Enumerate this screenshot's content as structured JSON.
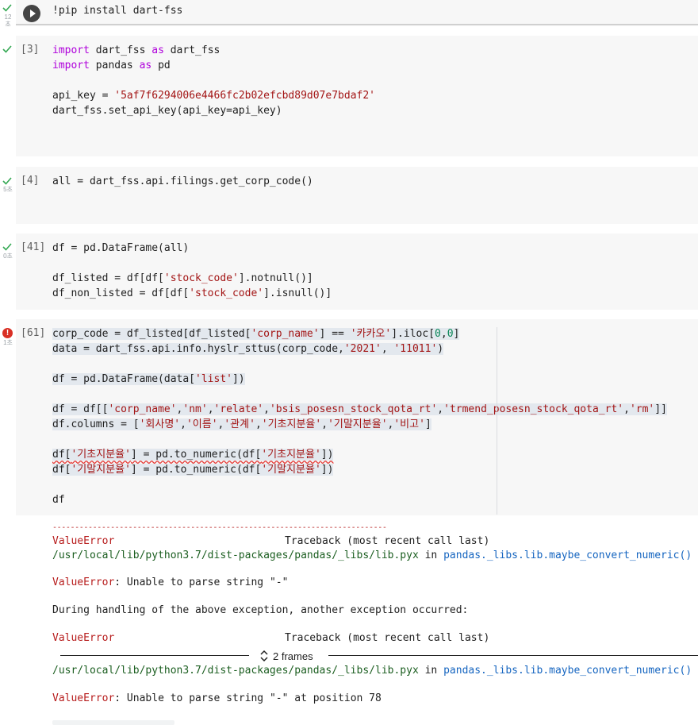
{
  "cells": {
    "c0": {
      "elapsed_num": "12",
      "elapsed_unit": "초",
      "code": "!pip install dart-fss"
    },
    "c1": {
      "count": "[3]",
      "lines": {
        "l1_a": "import",
        "l1_b": " dart_fss ",
        "l1_c": "as",
        "l1_d": " dart_fss",
        "l2_a": "import",
        "l2_b": " pandas ",
        "l2_c": "as",
        "l2_d": " pd",
        "l4_a": "api_key = ",
        "l4_b": "'5af7f6294006e4466fc2b02efcbd89d07e7bdaf2'",
        "l5": "dart_fss.set_api_key(api_key=api_key)"
      }
    },
    "c2": {
      "count": "[4]",
      "elapsed": "5초",
      "code": "all = dart_fss.api.filings.get_corp_code()"
    },
    "c3": {
      "count": "[41]",
      "elapsed": "0초",
      "l1": "df = pd.DataFrame(all)",
      "l3_a": "df_listed = df[df[",
      "l3_b": "'stock_code'",
      "l3_c": "].notnull()]",
      "l4_a": "df_non_listed = df[df[",
      "l4_b": "'stock_code'",
      "l4_c": "].isnull()]"
    },
    "c4": {
      "count": "[61]",
      "elapsed": "1초",
      "error_icon": "!",
      "l1_a": "corp_code = df_listed[df_listed[",
      "l1_b": "'corp_name'",
      "l1_c": "] == ",
      "l1_d": "'카카오'",
      "l1_e": "].iloc[",
      "l1_f": "0",
      "l1_g": ",",
      "l1_h": "0",
      "l1_i": "]",
      "l2_a": "data = dart_fss.api.info.hyslr_sttus(corp_code,",
      "l2_b": "'2021'",
      "l2_c": ", ",
      "l2_d": "'11011'",
      "l2_e": ")",
      "l4_a": "df = pd.DataFrame(data[",
      "l4_b": "'list'",
      "l4_c": "])",
      "l6_a": "df = df[[",
      "l6_b": "'corp_name'",
      "l6_c": ",",
      "l6_d": "'nm'",
      "l6_e": ",",
      "l6_f": "'relate'",
      "l6_g": ",",
      "l6_h": "'bsis_posesn_stock_qota_rt'",
      "l6_i": ",",
      "l6_j": "'trmend_posesn_stock_qota_rt'",
      "l6_k": ",",
      "l6_l": "'rm'",
      "l6_m": "]]",
      "l7_a": "df.columns = [",
      "l7_b": "'회사명'",
      "l7_c": ",",
      "l7_d": "'이름'",
      "l7_e": ",",
      "l7_f": "'관계'",
      "l7_g": ",",
      "l7_h": "'기초지분율'",
      "l7_i": ",",
      "l7_j": "'기말지분율'",
      "l7_k": ",",
      "l7_l": "'비고'",
      "l7_m": "]",
      "l9_a": "df[",
      "l9_b": "'기초지분율'",
      "l9_c": "] = pd.to_numeric(df[",
      "l9_d": "'기초지분율'",
      "l9_e": "])",
      "l10_a": "df[",
      "l10_b": "'기말지분율'",
      "l10_c": "] = pd.to_numeric(df[",
      "l10_d": "'기말지분율'",
      "l10_e": "])",
      "l12": "df"
    }
  },
  "output": {
    "dashes": "---------------------------------------------------------------------------",
    "e1_name": "ValueError",
    "e1_tb": "Traceback (most recent call last)",
    "e1_path": "/usr/local/lib/python3.7/dist-packages/pandas/_libs/lib.pyx",
    "in_word": " in ",
    "e1_func": "pandas._libs.lib.maybe_convert_numeric()",
    "e2_name": "ValueError",
    "e2_msg": ": Unable to parse string \"-\"",
    "during": "During handling of the above exception, another exception occurred:",
    "e3_name": "ValueError",
    "e3_tb": "Traceback (most recent call last)",
    "frames": "2 frames",
    "e4_path": "/usr/local/lib/python3.7/dist-packages/pandas/_libs/lib.pyx",
    "e4_func": "pandas._libs.lib.maybe_convert_numeric()",
    "e5_name": "ValueError",
    "e5_msg": ": Unable to parse string \"-\" at position 78"
  }
}
